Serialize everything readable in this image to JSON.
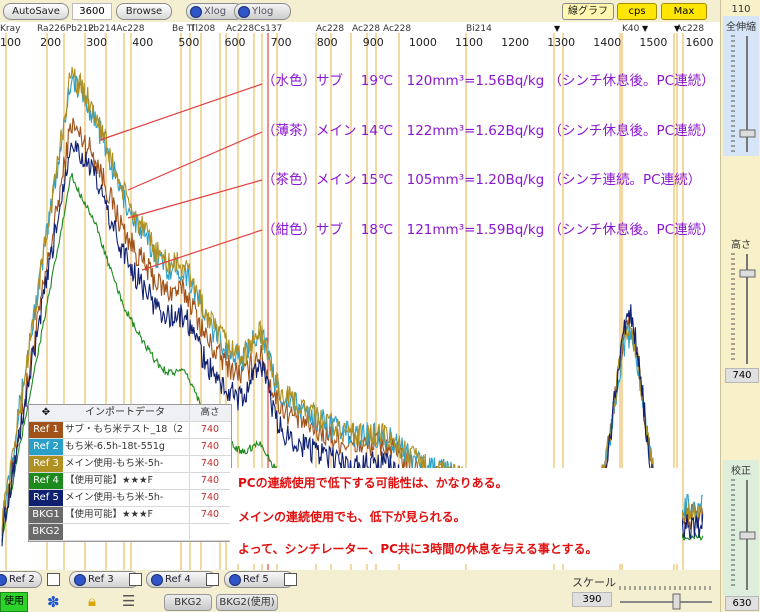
{
  "toolbar": {
    "autosave": "AutoSave",
    "value": "3600",
    "browse": "Browse",
    "xlog": "Xlog",
    "ylog": "Ylog",
    "line_graph": "線グラフ",
    "cps": "cps",
    "max": "Max"
  },
  "axis": {
    "ticks": [
      "100",
      "200",
      "300",
      "400",
      "500",
      "600",
      "700",
      "800",
      "900",
      "1000",
      "1100",
      "1200",
      "1300",
      "1400",
      "1500",
      "1600"
    ],
    "peak_labels": [
      "Kray",
      "Ra226",
      "Pb212",
      "Pb214",
      "Ac228",
      "Ra226",
      "Pb214",
      "Ac228",
      "Bi214",
      "Ra226",
      "Ac228",
      "Bi214",
      "Pb214",
      "Cs137",
      "Ac228",
      "Bi214",
      "Tl208",
      "Ac228",
      "Cs137",
      "Ac228",
      "Ac228",
      "Bi214",
      "K40",
      "Ac228"
    ],
    "peak_label_text": {
      "kray": "Kray",
      "ra226_pb212": "Ra226Pb212",
      "pb214_ac228": "Pb214Ac228",
      "bi_tl208": "Tl208",
      "be_tl": "Be Tl",
      "ac228_cs": "Ac228Cs137",
      "ac228_a": "Ac228",
      "ac228_b": "Ac228 Ac228",
      "bi214": "Bi214",
      "k40": "K40",
      "ac228_end": "Ac228"
    }
  },
  "annotations": [
    "（水色）サブ　 19℃　120mm³=1.56Bq/kg （シンチ休息後。PC連続）",
    "（薄茶）メイン 14℃　122mm³=1.62Bq/kg （シンチ休息後。PC連続）",
    "（茶色）メイン 15℃　105mm³=1.20Bq/kg （シンチ連続。PC連続）",
    "（紺色）サブ　 18℃　121mm³=1.59Bq/kg （シンチ休息後。PC連続）"
  ],
  "ref_table": {
    "header_name": "インポートデータ",
    "header_height": "高さ",
    "rows": [
      {
        "tag": "Ref 1",
        "name": "サブ・もち米テスト_18（2",
        "height": "740",
        "color": "#a0521a"
      },
      {
        "tag": "Ref 2",
        "name": "もち米-6.5h-18t-551g",
        "height": "740",
        "color": "#2aa0c8"
      },
      {
        "tag": "Ref 3",
        "name": "メイン使用-もち米-5h-",
        "height": "740",
        "color": "#b09020"
      },
      {
        "tag": "Ref 4",
        "name": "【使用可能】★★★F",
        "height": "740",
        "color": "#1c8a1c"
      },
      {
        "tag": "Ref 5",
        "name": "メイン使用-もち米-5h-",
        "height": "740",
        "color": "#102070"
      },
      {
        "tag": "BKG1",
        "name": "【使用可能】★★★F",
        "height": "740",
        "color": "#6a6a6a"
      },
      {
        "tag": "BKG2",
        "name": "",
        "height": "",
        "color": "#6a6a6a"
      }
    ]
  },
  "notes": [
    "PCの連続使用で低下する可能性は、かなりある。",
    "メインの連続使用でも、低下が見られる。",
    "よって、シンチレーター、PC共に3時間の休息を与える事とする。"
  ],
  "bottom": {
    "ref2": "Ref 2",
    "ref3": "Ref 3",
    "ref4": "Ref 4",
    "ref5": "Ref 5",
    "use": "使用",
    "bkg2": "BKG2",
    "bkg2_use": "BKG2(使用)",
    "scale_label": "スケール",
    "scale_value": "390"
  },
  "right_panel": {
    "top_value": "110",
    "zoom_label": "全伸縮",
    "height_label": "高さ",
    "height_value": "740",
    "calib_label": "校正",
    "calib_value": "630"
  },
  "chart_data": {
    "type": "line",
    "xlim": [
      100,
      1620
    ],
    "series": [
      {
        "name": "Ref 1",
        "color": "#a0521a",
        "peak_y": 0.77
      },
      {
        "name": "Ref 2",
        "color": "#2aa0c8",
        "peak_y": 0.84
      },
      {
        "name": "Ref 3",
        "color": "#b09020",
        "peak_y": 0.86
      },
      {
        "name": "Ref 4",
        "color": "#1c8a1c",
        "peak_y": 0.69
      },
      {
        "name": "Ref 5",
        "color": "#102070",
        "peak_y": 0.75
      }
    ]
  }
}
